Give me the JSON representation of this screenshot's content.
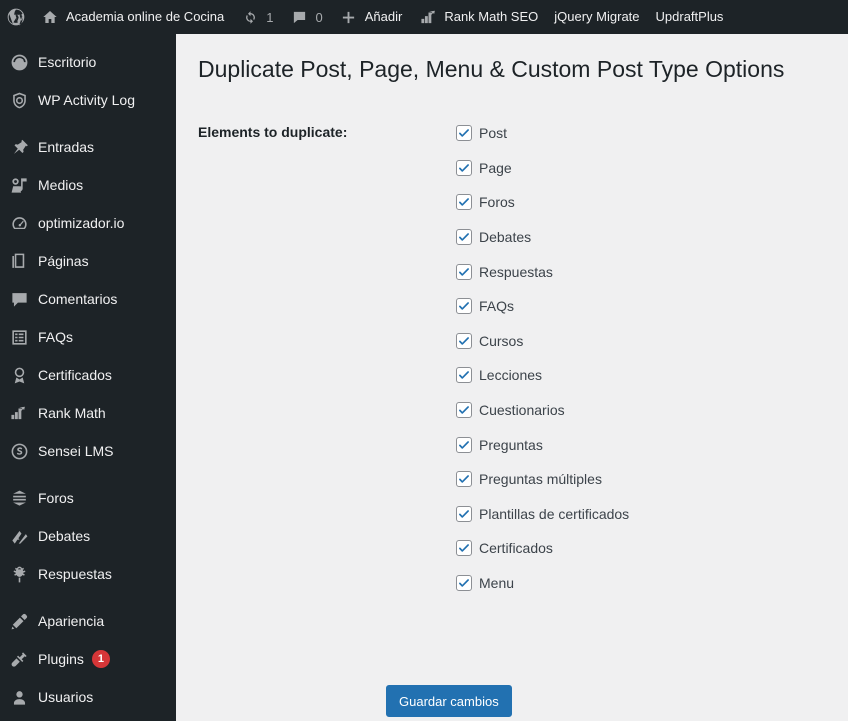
{
  "adminbar": {
    "items": [
      {
        "icon": "wordpress-logo-icon",
        "label": "",
        "count": null
      },
      {
        "icon": "home-icon",
        "label": "Academia online de Cocina",
        "count": null
      },
      {
        "icon": "updates-icon",
        "label": "",
        "count": "1"
      },
      {
        "icon": "comment-bubble-icon",
        "label": "",
        "count": "0"
      },
      {
        "icon": "plus-icon",
        "label": "Añadir",
        "count": null
      },
      {
        "icon": "rank-math-icon",
        "label": "Rank Math SEO",
        "count": null
      },
      {
        "icon": "",
        "label": "jQuery Migrate",
        "count": null
      },
      {
        "icon": "",
        "label": "UpdraftPlus",
        "count": null
      }
    ]
  },
  "sidebar": {
    "groups": [
      {
        "items": [
          {
            "icon": "dashboard-icon",
            "label": "Escritorio",
            "badge": null
          },
          {
            "icon": "shield-icon",
            "label": "WP Activity Log",
            "badge": null
          }
        ]
      },
      {
        "items": [
          {
            "icon": "pin-icon",
            "label": "Entradas",
            "badge": null
          },
          {
            "icon": "media-icon",
            "label": "Medios",
            "badge": null
          },
          {
            "icon": "gauge-icon",
            "label": "optimizador.io",
            "badge": null
          },
          {
            "icon": "pages-icon",
            "label": "Páginas",
            "badge": null
          },
          {
            "icon": "comment-icon",
            "label": "Comentarios",
            "badge": null
          },
          {
            "icon": "list-icon",
            "label": "FAQs",
            "badge": null
          },
          {
            "icon": "award-icon",
            "label": "Certificados",
            "badge": null
          },
          {
            "icon": "rank-math-icon",
            "label": "Rank Math",
            "badge": null
          },
          {
            "icon": "sensei-icon",
            "label": "Sensei LMS",
            "badge": null
          }
        ]
      },
      {
        "items": [
          {
            "icon": "forums-icon",
            "label": "Foros",
            "badge": null
          },
          {
            "icon": "topics-icon",
            "label": "Debates",
            "badge": null
          },
          {
            "icon": "replies-icon",
            "label": "Respuestas",
            "badge": null
          }
        ]
      },
      {
        "items": [
          {
            "icon": "appearance-brush-icon",
            "label": "Apariencia",
            "badge": null
          },
          {
            "icon": "plugins-plug-icon",
            "label": "Plugins",
            "badge": "1"
          },
          {
            "icon": "users-icon",
            "label": "Usuarios",
            "badge": null
          }
        ]
      }
    ]
  },
  "main": {
    "title": "Duplicate Post, Page, Menu & Custom Post Type Options",
    "form_label": "Elements to duplicate:",
    "checkboxes": [
      {
        "label": "Post",
        "checked": true
      },
      {
        "label": "Page",
        "checked": true
      },
      {
        "label": "Foros",
        "checked": true
      },
      {
        "label": "Debates",
        "checked": true
      },
      {
        "label": "Respuestas",
        "checked": true
      },
      {
        "label": "FAQs",
        "checked": true
      },
      {
        "label": "Cursos",
        "checked": true
      },
      {
        "label": "Lecciones",
        "checked": true
      },
      {
        "label": "Cuestionarios",
        "checked": true
      },
      {
        "label": "Preguntas",
        "checked": true
      },
      {
        "label": "Preguntas múltiples",
        "checked": true
      },
      {
        "label": "Plantillas de certificados",
        "checked": true
      },
      {
        "label": "Certificados",
        "checked": true
      },
      {
        "label": "Menu",
        "checked": true
      }
    ],
    "save_label": "Guardar cambios"
  },
  "colors": {
    "admin_dark": "#1d2327",
    "content_bg": "#f0f0f1",
    "accent_blue": "#2271b1",
    "badge_red": "#d63638",
    "icon_gray": "#a7aaad"
  }
}
